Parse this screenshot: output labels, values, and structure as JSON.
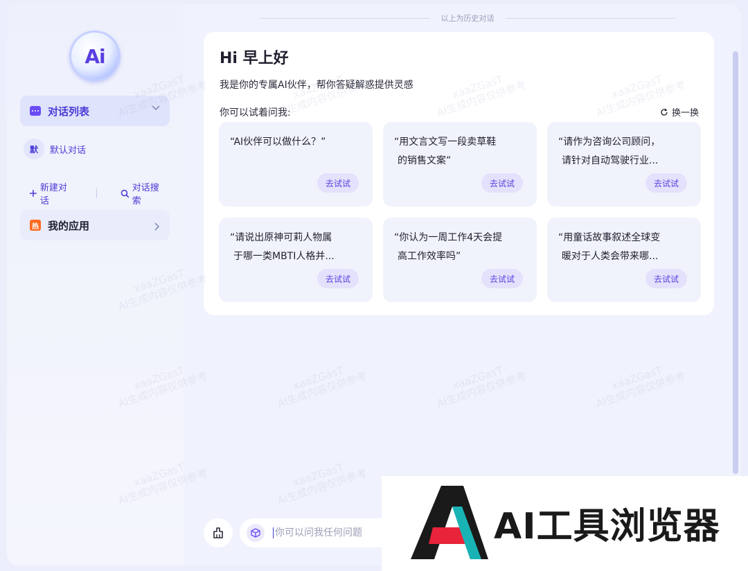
{
  "sidebar": {
    "logo_text": "Ai",
    "conversation_list_label": "对话列表",
    "default_chat": {
      "avatar": "默",
      "label": "默认对话"
    },
    "new_chat_label": "新建对话",
    "search_chat_label": "对话搜索",
    "my_apps": {
      "badge": "热",
      "label": "我的应用"
    }
  },
  "main": {
    "history_label": "以上为历史对话",
    "greeting": "Hi 早上好",
    "intro": "我是你的专属AI伙伴，帮你答疑解惑提供灵感",
    "try_asking": "你可以试着问我:",
    "refresh_label": "换一换",
    "suggestions": [
      {
        "lines": [
          "“AI伙伴可以做什么？”"
        ],
        "button": "去试试"
      },
      {
        "lines": [
          "“用文言文写一段卖草鞋",
          "的销售文案”"
        ],
        "button": "去试试"
      },
      {
        "lines": [
          "“请作为咨询公司顾问，",
          "请针对自动驾驶行业..."
        ],
        "button": "去试试"
      },
      {
        "lines": [
          "“请说出原神可莉人物属",
          "于哪一类MBTI人格并..."
        ],
        "button": "去试试"
      },
      {
        "lines": [
          "“你认为一周工作4天会提",
          "高工作效率吗”"
        ],
        "button": "去试试"
      },
      {
        "lines": [
          "“用童话故事叙述全球变",
          "暖对于人类会带来哪..."
        ],
        "button": "去试试"
      }
    ]
  },
  "input": {
    "placeholder": "你可以问我任何问题"
  },
  "watermark": {
    "line1": "xaaZGasT",
    "line2": "AI生成内容仅供参考"
  },
  "brand_overlay": {
    "text": "AI工具浏览器"
  },
  "colors": {
    "accent": "#5b3fe0",
    "card_bg": "#f1f3fc",
    "hot": "#ff6a1f"
  }
}
